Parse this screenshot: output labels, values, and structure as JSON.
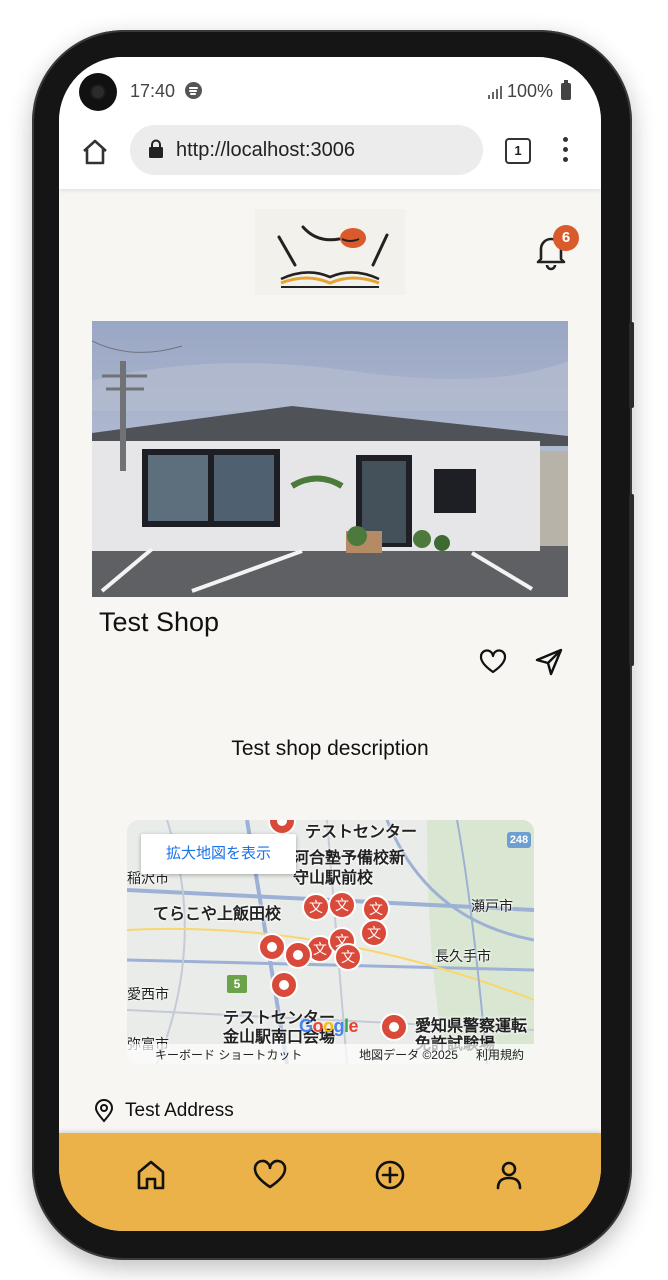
{
  "status_bar": {
    "time": "17:40",
    "battery": "100%",
    "icons": [
      "spotify-icon",
      "signal-icon",
      "battery-icon"
    ]
  },
  "browser": {
    "url": "http://localhost:3006",
    "tab_count": "1",
    "icons": [
      "home-icon",
      "lock-icon",
      "tabs-icon",
      "more-vert-icon"
    ]
  },
  "header": {
    "logo": "book-logo",
    "notification_count": "6"
  },
  "shop": {
    "name": "Test Shop",
    "description": "Test shop description",
    "address": "Test Address",
    "actions": [
      "favorite-icon",
      "share-send-icon"
    ]
  },
  "map": {
    "expand_label": "拡大地図を表示",
    "labels": {
      "test_center_top": "テストセンター",
      "prep_school": "河合塾予備校新",
      "moriyama_station": "守山駅前校",
      "terakoya": "てらこや上飯田校",
      "seto": "瀬戸市",
      "nagakute": "長久手市",
      "aisai": "愛西市",
      "test_center_bottom": "テストセンター",
      "kanayama": "金山駅南口会場",
      "aichi_police": "愛知県警察運転",
      "license_test": "免許試験場",
      "inazawa": "稲沢市",
      "yatomi": "弥富市",
      "route_248": "248",
      "route_5": "5"
    },
    "footer": {
      "shortcuts": "キーボード ショートカット",
      "map_data": "地図データ ©2025",
      "terms": "利用規約"
    },
    "google": "Google"
  },
  "bottom_nav": {
    "items": [
      "home-icon",
      "favorites-icon",
      "add-icon",
      "profile-icon"
    ],
    "background": "#ecb24a"
  },
  "colors": {
    "accent": "#ecb24a",
    "badge": "#d95a2b",
    "page_background": "#f7f6f2"
  }
}
